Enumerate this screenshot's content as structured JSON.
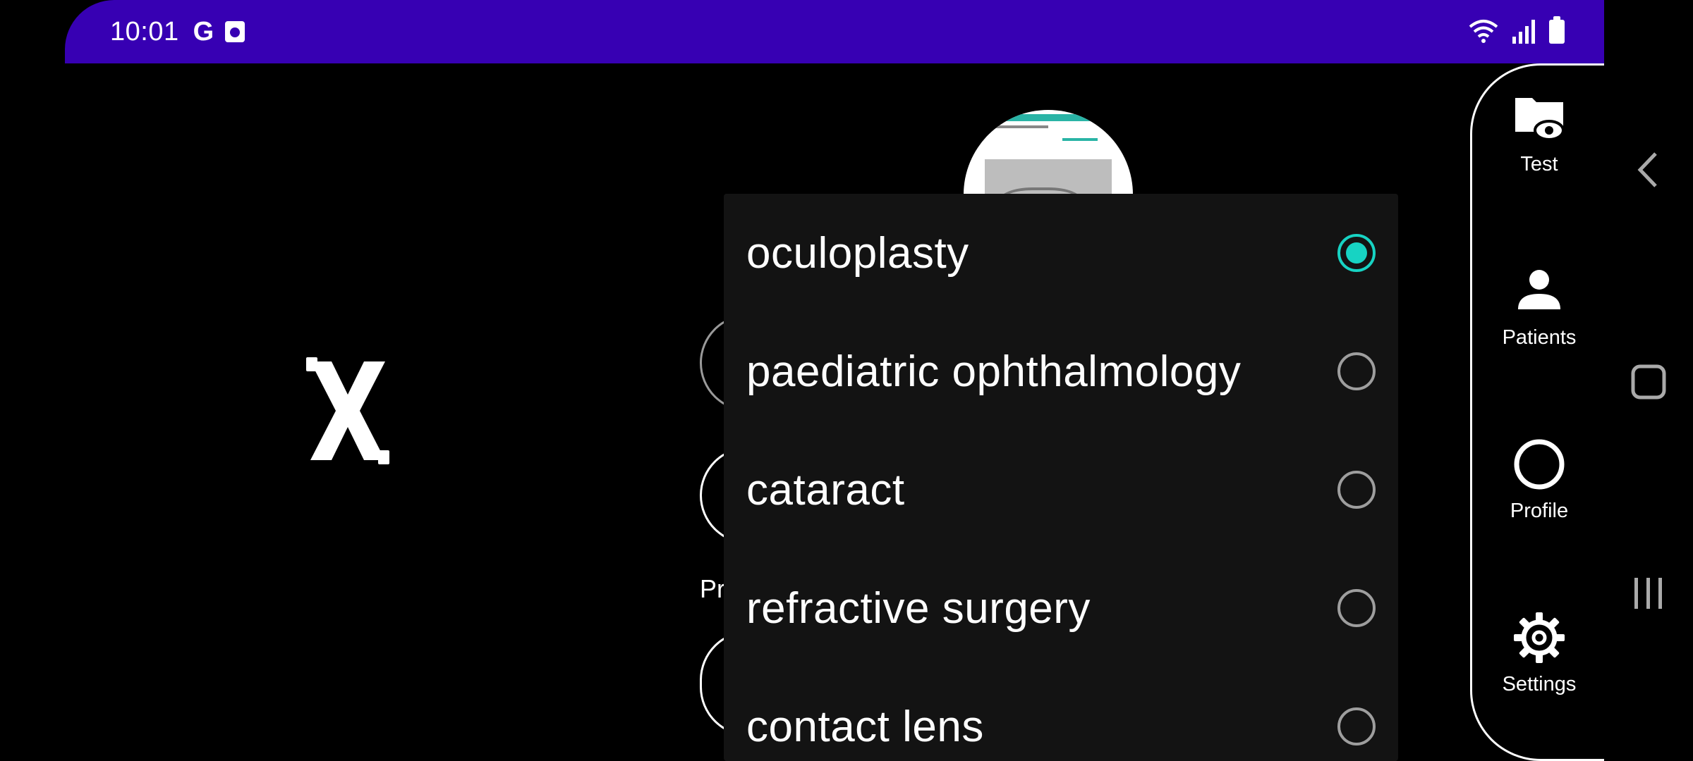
{
  "status_bar": {
    "time": "10:01",
    "g_glyph": "G",
    "icons": [
      "google-icon",
      "calendar-icon",
      "wifi-icon",
      "signal-icon",
      "battery-icon"
    ],
    "color": "#3700b3"
  },
  "dropdown": {
    "accent_color": "#17d3c3",
    "options": [
      {
        "label": "oculoplasty",
        "selected": true
      },
      {
        "label": "paediatric ophthalmology",
        "selected": false
      },
      {
        "label": "cataract",
        "selected": false
      },
      {
        "label": "refractive surgery",
        "selected": false
      },
      {
        "label": "contact lens",
        "selected": false
      }
    ]
  },
  "background": {
    "partial_label": "Pr"
  },
  "nav_rail": {
    "items": [
      {
        "label": "Test",
        "icon": "folder-eye-icon"
      },
      {
        "label": "Patients",
        "icon": "person-icon"
      },
      {
        "label": "Profile",
        "icon": "circle-icon"
      },
      {
        "label": "Settings",
        "icon": "gear-icon"
      }
    ]
  },
  "system_nav": {
    "buttons": [
      "back-icon",
      "home-icon",
      "recents-icon"
    ]
  }
}
